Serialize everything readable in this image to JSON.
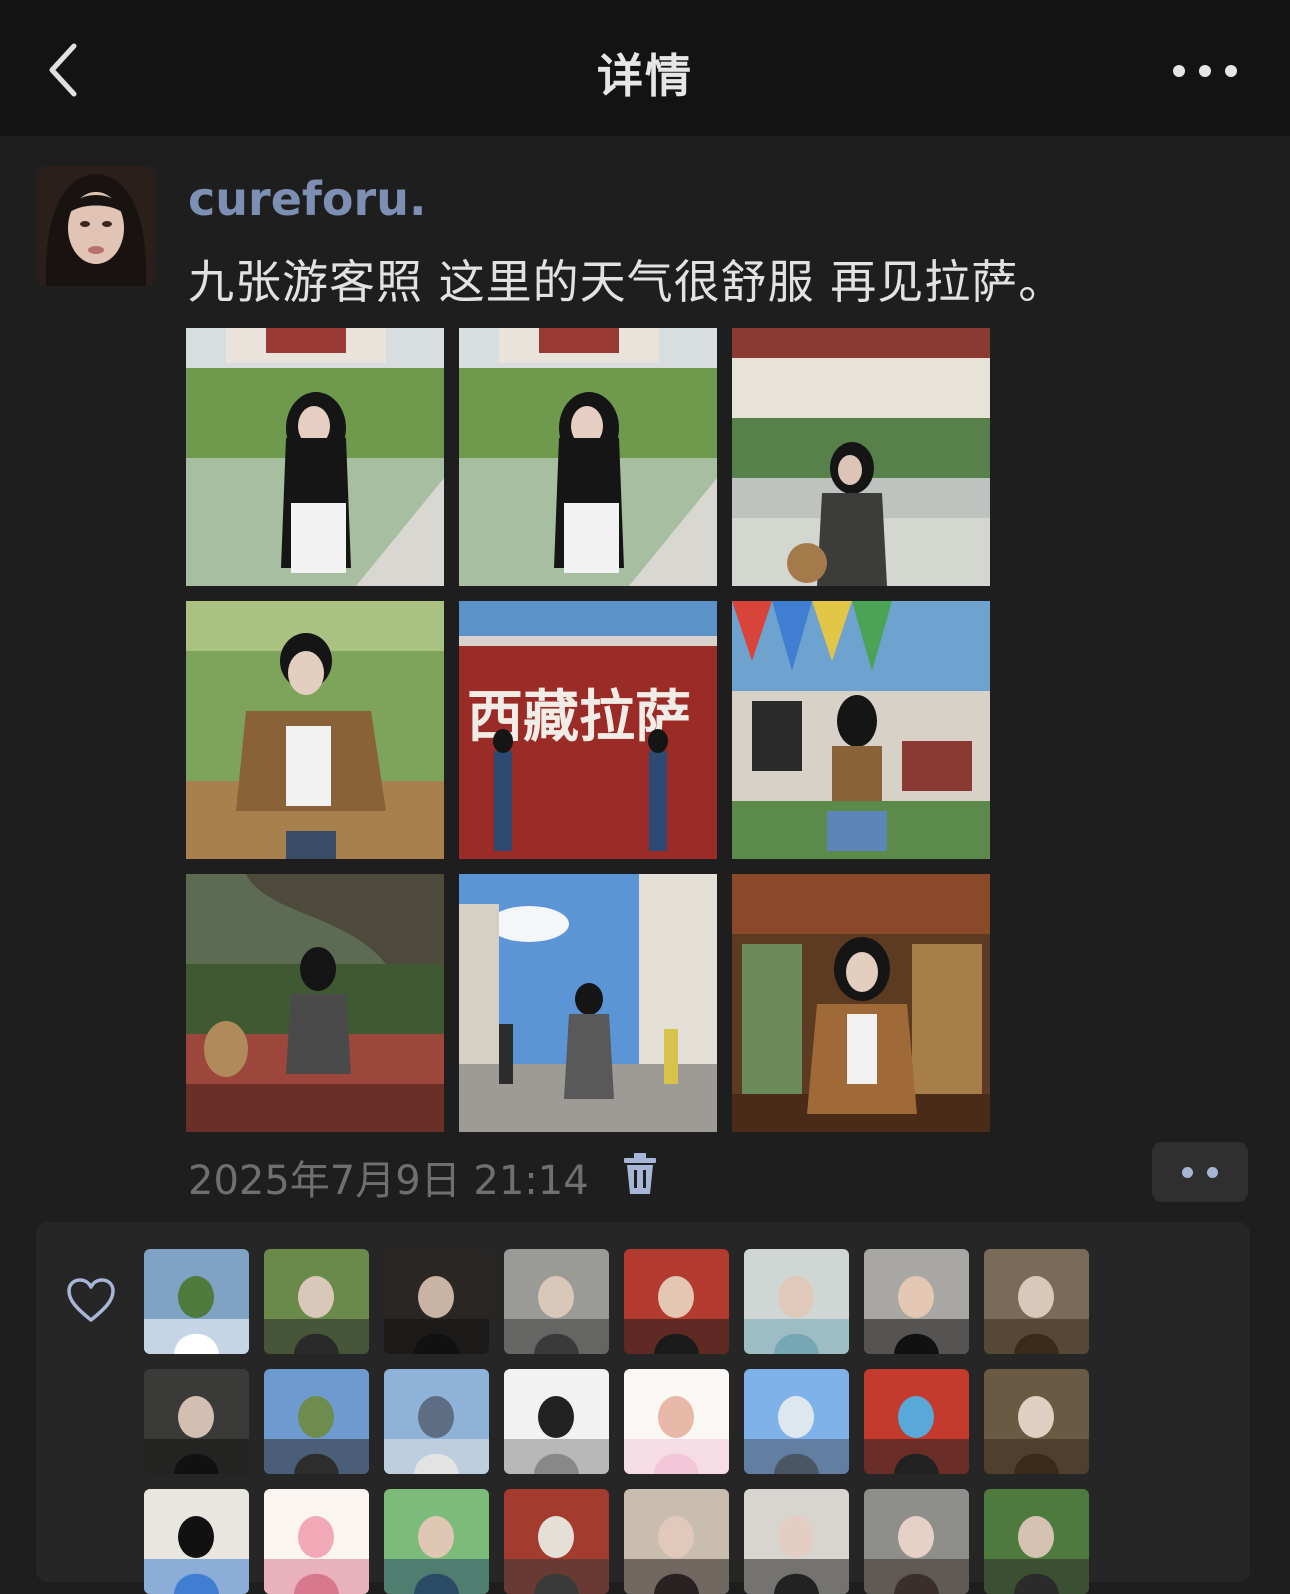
{
  "header": {
    "title": "详情",
    "back_icon": "chevron-left-icon",
    "more_icon": "more-horizontal-icon"
  },
  "post": {
    "username": "cureforu.",
    "text": "九张游客照 这里的天气很舒服 再见拉萨。",
    "timestamp": "2025年7月9日 21:14",
    "delete_icon": "trash-icon",
    "comment_icon": "comment-dots-icon",
    "photos": [
      {
        "theme": "palace-lake-railing-long-hair"
      },
      {
        "theme": "palace-lake-railing-long-hair"
      },
      {
        "theme": "potala-palace-sunglasses"
      },
      {
        "theme": "green-hill-brown-jacket"
      },
      {
        "theme": "red-wall-calligraphy",
        "wall_text": "西藏拉萨"
      },
      {
        "theme": "prayer-flags-building"
      },
      {
        "theme": "tree-bench-grey-sweater"
      },
      {
        "theme": "street-crowd-blue-sky"
      },
      {
        "theme": "tibetan-doorway-brown-jacket"
      }
    ]
  },
  "likes": {
    "icon": "heart-outline-icon",
    "avatars": [
      "horse-meadow",
      "girl-sitting-grass",
      "girl-black-hair",
      "girl-grey-sweater",
      "girl-red-decor",
      "girl-teal-hat",
      "girl-cake-plate",
      "girl-holding-dog",
      "person-dark-room",
      "mountain-horse",
      "seaside-table",
      "manga-sketch",
      "cartoon-bear",
      "fighter-jet",
      "person-blue-hat",
      "girl-bunny-ears",
      "cartoon-boy",
      "pink-pig",
      "anime-couple",
      "temple-lanterns",
      "girl-portrait",
      "girl-with-cat",
      "girl-smiling",
      "person-with-dog"
    ]
  },
  "colors": {
    "topbar": "#131313",
    "background": "#1e1e1e",
    "username": "#7d90b4",
    "timestamp": "#6f6f6f",
    "panel": "#262626",
    "comment_dots": "#a7b6d6"
  }
}
